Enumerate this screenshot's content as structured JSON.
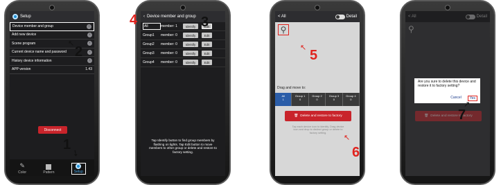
{
  "screen1": {
    "title": "Setup",
    "items": [
      {
        "label": "Device member and group",
        "value": ""
      },
      {
        "label": "Add new device",
        "value": ""
      },
      {
        "label": "Scene program",
        "value": ""
      },
      {
        "label": "Current device name and password",
        "value": ""
      },
      {
        "label": "History device information",
        "value": ""
      },
      {
        "label": "APP version",
        "value": "1.43"
      }
    ],
    "disconnect": "Disconnect",
    "tabs": [
      "Color",
      "Pattern",
      "Setup"
    ]
  },
  "screen2": {
    "title": "Device member and group",
    "groups": [
      {
        "name": "All",
        "member": "member: 1"
      },
      {
        "name": "Group1",
        "member": "member: 0"
      },
      {
        "name": "Group2",
        "member": "member: 0"
      },
      {
        "name": "Group3",
        "member": "member: 0"
      },
      {
        "name": "Group4",
        "member": "member: 0"
      }
    ],
    "identify": "Identify",
    "edit": "Edit",
    "help": "Tap Identify button to find group members by flashing on lights. Tap Edit button to move members to other group or delete and restore to factory setting."
  },
  "screen3": {
    "back": "<",
    "title": "All",
    "detail": "Detail",
    "drag": "Drag and move to:",
    "targets": [
      {
        "name": "All",
        "count": "1"
      },
      {
        "name": "Group 1",
        "count": "0"
      },
      {
        "name": "Group 2",
        "count": "0"
      },
      {
        "name": "Group 3",
        "count": "0"
      },
      {
        "name": "Group 4",
        "count": "0"
      }
    ],
    "delete": "Delete and restore to factory",
    "hint": "Tap each device icon to identify. Drag device icon and drop to distinct group or delete to factory setting."
  },
  "screen4": {
    "back": "<",
    "title": "All",
    "detail": "Detail",
    "question": "Are you sure to delete this device and restore it to factory setting?",
    "cancel": "Cancel",
    "yes": "Yes",
    "delete": "Delete and restore to factory"
  },
  "callouts": {
    "c1": "1",
    "c2": "2",
    "c3": "3",
    "c4": "4",
    "c5": "5",
    "c6": "6",
    "c7": "7"
  },
  "colors": {
    "accent": "#1e8fd6",
    "red": "#c9242b",
    "callout": "#e0231e"
  },
  "icons": [
    "gear-icon",
    "chevron-right-icon",
    "palette-icon",
    "pattern-icon",
    "trash-icon",
    "lamp-icon",
    "back-arrow-icon"
  ]
}
